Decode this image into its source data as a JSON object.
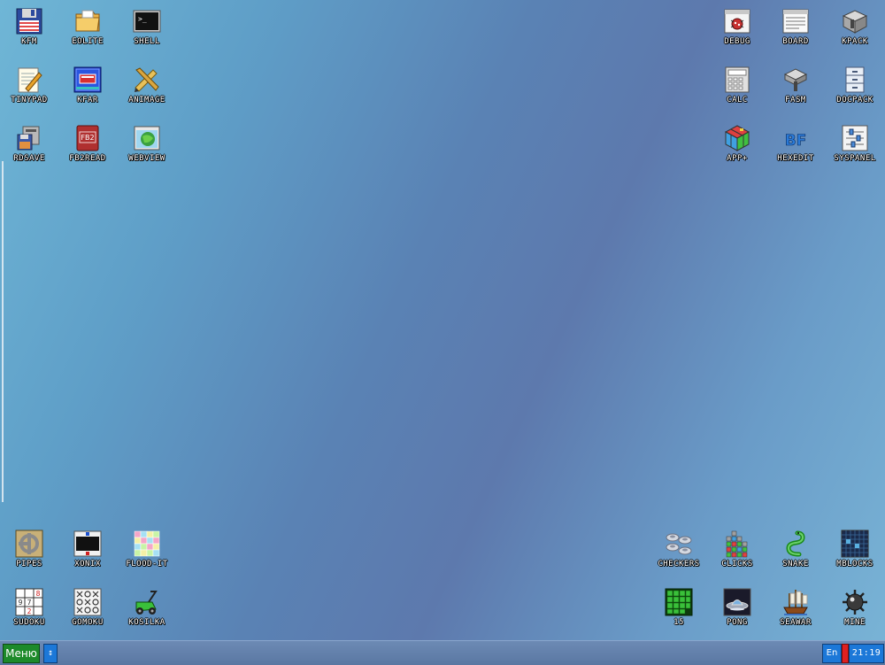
{
  "desktop": {
    "icons": [
      {
        "id": "kfm",
        "label": "KFM"
      },
      {
        "id": "eolite",
        "label": "EOLITE"
      },
      {
        "id": "shell",
        "label": "SHELL"
      },
      {
        "id": "tinypad",
        "label": "TINYPAD"
      },
      {
        "id": "kfar",
        "label": "KFAR"
      },
      {
        "id": "animage",
        "label": "ANIMAGE"
      },
      {
        "id": "rdsave",
        "label": "RDSAVE"
      },
      {
        "id": "fb2read",
        "label": "FB2READ"
      },
      {
        "id": "webview",
        "label": "WEBVIEW"
      },
      {
        "id": "debug",
        "label": "DEBUG"
      },
      {
        "id": "board",
        "label": "BOARD"
      },
      {
        "id": "kpack",
        "label": "KPACK"
      },
      {
        "id": "calc",
        "label": "CALC"
      },
      {
        "id": "fasm",
        "label": "FASM"
      },
      {
        "id": "docpack",
        "label": "DOCPACK"
      },
      {
        "id": "app_plus",
        "label": "APP+"
      },
      {
        "id": "hexedit",
        "label": "HEXEDIT"
      },
      {
        "id": "syspanel",
        "label": "SYSPANEL"
      },
      {
        "id": "pipes",
        "label": "PIPES"
      },
      {
        "id": "xonix",
        "label": "XONIX"
      },
      {
        "id": "flood_it",
        "label": "FLOOD-IT"
      },
      {
        "id": "sudoku",
        "label": "SUDOKU"
      },
      {
        "id": "gomoku",
        "label": "GOMOKU"
      },
      {
        "id": "kosilka",
        "label": "KOSILKA"
      },
      {
        "id": "checkers",
        "label": "CHECKERS"
      },
      {
        "id": "clicks",
        "label": "CLICKS"
      },
      {
        "id": "snake",
        "label": "SNAKE"
      },
      {
        "id": "mblocks",
        "label": "MBLOCKS"
      },
      {
        "id": "game15",
        "label": "15"
      },
      {
        "id": "pong",
        "label": "PONG"
      },
      {
        "id": "seawar",
        "label": "SEAWAR"
      },
      {
        "id": "mine",
        "label": "MINE"
      }
    ],
    "fb2_icon_text": "FB2",
    "hexedit_icon_text": "BF",
    "sudoku_icon_digits": [
      "8",
      "9",
      "7",
      "2"
    ],
    "shell_prompt": ">_"
  },
  "taskbar": {
    "menu_label": "Меню",
    "switch_icon": "↕",
    "language": "En",
    "clock": "21:19"
  },
  "colors": {
    "menu_button": "#1d8a2a",
    "taskbar_button": "#1c78d8",
    "indicator_red": "#e02020"
  }
}
